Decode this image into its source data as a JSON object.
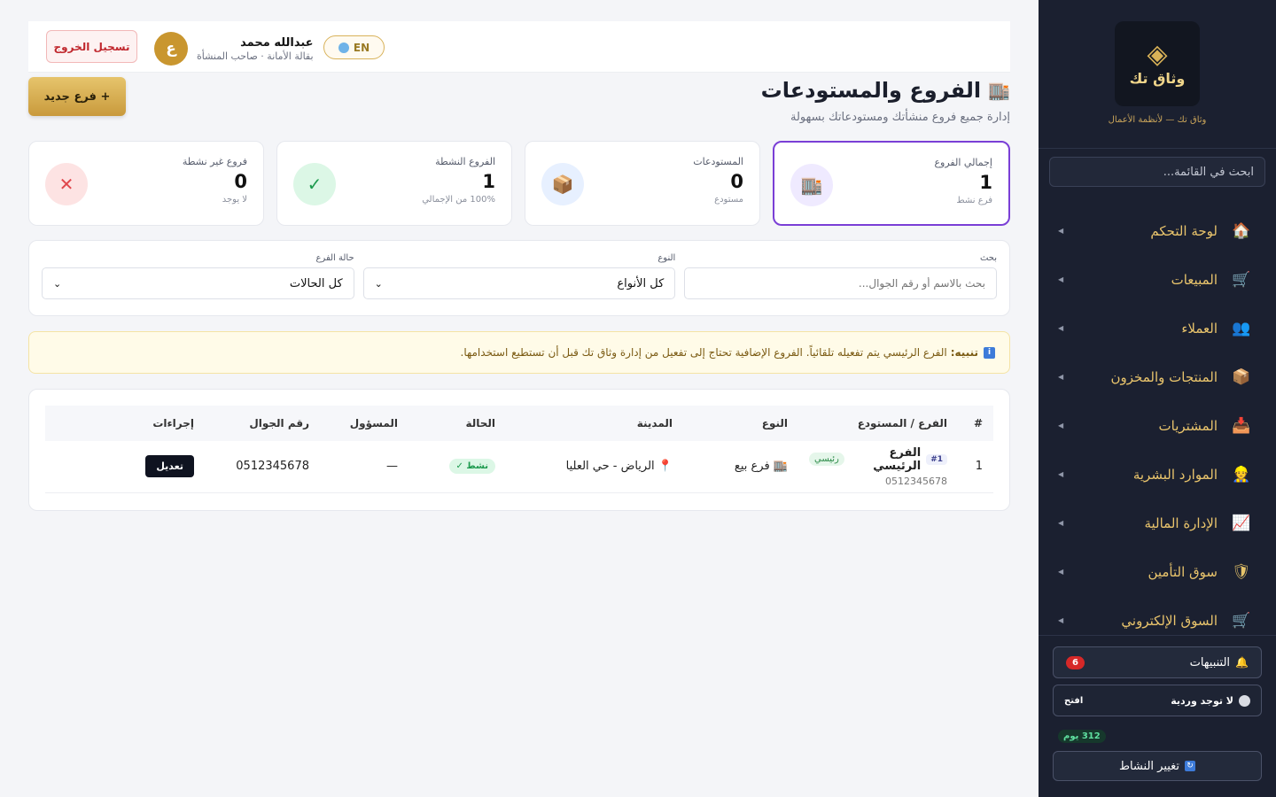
{
  "sidebar": {
    "logo_name": "وثاق تك",
    "logo_tagline": "وثاق تك — لأنظمة الأعمال",
    "search_placeholder": "ابحث في القائمة...",
    "items": [
      {
        "label": "لوحة التحكم",
        "icon": "house-icon",
        "glyph": "🏠"
      },
      {
        "label": "المبيعات",
        "icon": "cart-icon",
        "glyph": "🛒"
      },
      {
        "label": "العملاء",
        "icon": "users-icon",
        "glyph": "👥"
      },
      {
        "label": "المنتجات والمخزون",
        "icon": "box-icon",
        "glyph": "📦"
      },
      {
        "label": "المشتريات",
        "icon": "inbox-icon",
        "glyph": "📥"
      },
      {
        "label": "الموارد البشرية",
        "icon": "person-icon",
        "glyph": "👷"
      },
      {
        "label": "الإدارة المالية",
        "icon": "chart-up-icon",
        "glyph": "📈"
      },
      {
        "label": "سوق التأمين",
        "icon": "shield-icon",
        "glyph": "🛡"
      },
      {
        "label": "السوق الإلكتروني",
        "icon": "cart-icon",
        "glyph": "🛒"
      }
    ],
    "notifications_label": "التنبيهات",
    "notifications_count": "6",
    "shift_label": "لا توجد وردية",
    "shift_open": "افتح",
    "days_left": "312 يوم",
    "switch_label": "تغيير النشاط"
  },
  "topbar": {
    "logout_label": "تسجيل الخروج",
    "user_name": "عبدالله محمد",
    "user_role": "بقالة الأمانة · صاحب المنشأة",
    "avatar_letter": "ع",
    "lang_label": "EN"
  },
  "page": {
    "title": "الفروع والمستودعات",
    "title_icon": "🏬",
    "subtitle": "إدارة جميع فروع منشأتك ومستودعاتك بسهولة",
    "new_button": "+ فرع جديد"
  },
  "stats": [
    {
      "label": "إجمالي الفروع",
      "value": "1",
      "note": "فرع نشط",
      "glyph": "🏬",
      "bg": "#efeaff"
    },
    {
      "label": "المستودعات",
      "value": "0",
      "note": "مستودع",
      "glyph": "📦",
      "bg": "#e7f0ff"
    },
    {
      "label": "الفروع النشطة",
      "value": "1",
      "note": "100% من الإجمالي",
      "glyph": "✓",
      "bg": "#dcf7e6"
    },
    {
      "label": "فروع غير نشطة",
      "value": "0",
      "note": "لا يوجد",
      "glyph": "✕",
      "bg": "#fde3e3"
    }
  ],
  "filters": {
    "search_label": "بحث",
    "search_placeholder": "بحث بالاسم أو رقم الجوال...",
    "type_label": "النوع",
    "type_value": "كل الأنواع",
    "status_label": "حالة الفرع",
    "status_value": "كل الحالات"
  },
  "notice": {
    "bold": "تنبيه:",
    "text": "الفرع الرئيسي يتم تفعيله تلقائياً. الفروع الإضافية تحتاج إلى تفعيل من إدارة وثاق تك قبل أن تستطيع استخدامها."
  },
  "table": {
    "headers": [
      "#",
      "الفرع / المستودع",
      "النوع",
      "المدينة",
      "الحالة",
      "المسؤول",
      "رقم الجوال",
      "إجراءات"
    ],
    "rows": [
      {
        "index": "1",
        "num_tag": "#1",
        "name": "الفرع الرئيسي",
        "main_tag": "رئيسي",
        "phone_sub": "0512345678",
        "type": "فرع بيع",
        "type_glyph": "🏬",
        "city": "الرياض - حي العليا",
        "city_glyph": "📍",
        "status": "نشط ✓",
        "manager": "—",
        "phone": "0512345678",
        "action": "تعديل"
      }
    ]
  }
}
